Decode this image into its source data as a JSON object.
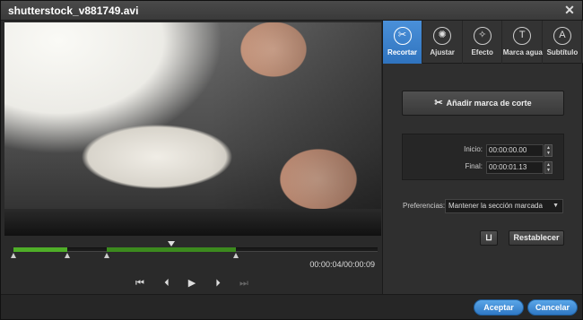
{
  "window": {
    "title": "shutterstock_v881749.avi",
    "close_icon": "close-icon"
  },
  "player": {
    "timecode": "00:00:04/00:00:09",
    "playhead_fraction": 0.44,
    "segments": [
      {
        "start": 0.0,
        "end": 0.15
      },
      {
        "start": 0.26,
        "end": 0.62
      }
    ]
  },
  "controls": {
    "items": [
      {
        "name": "skip-back-icon",
        "glyph": "⏮"
      },
      {
        "name": "step-back-icon",
        "glyph": "⏴"
      },
      {
        "name": "play-icon",
        "glyph": "▶"
      },
      {
        "name": "step-forward-icon",
        "glyph": "⏵"
      },
      {
        "name": "skip-forward-icon",
        "glyph": "⏭"
      }
    ]
  },
  "tabs": [
    {
      "label": "Recortar",
      "icon": "scissors-icon",
      "glyph": "✂",
      "active": true
    },
    {
      "label": "Ajustar",
      "icon": "adjust-icon",
      "glyph": "✺",
      "active": false
    },
    {
      "label": "Efecto",
      "icon": "wand-icon",
      "glyph": "✧",
      "active": false
    },
    {
      "label": "Marca agua",
      "icon": "watermark-icon",
      "glyph": "T",
      "active": false
    },
    {
      "label": "Subtítulo",
      "icon": "subtitle-icon",
      "glyph": "A",
      "active": false
    }
  ],
  "trim": {
    "add_cut_label": "Añadir marca de corte",
    "start_label": "Inicio:",
    "start_value": "00:00:00.00",
    "end_label": "Final:",
    "end_value": "00:00:01.13",
    "preferences_label": "Preferencias:",
    "preferences_value": "Mantener la sección marcada",
    "reset_label": "Restablecer"
  },
  "footer": {
    "accept_label": "Aceptar",
    "cancel_label": "Cancelar"
  },
  "colors": {
    "accent": "#3a8ad6",
    "segment_green": "#4fae28"
  }
}
